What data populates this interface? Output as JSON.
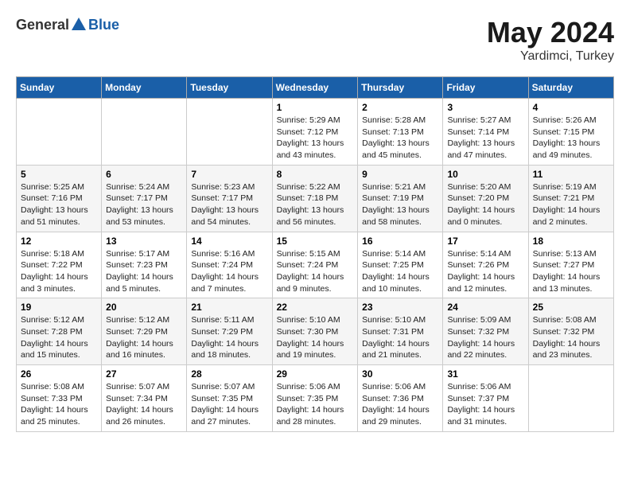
{
  "logo": {
    "text_general": "General",
    "text_blue": "Blue"
  },
  "title": {
    "month_year": "May 2024",
    "location": "Yardimci, Turkey"
  },
  "weekdays": [
    "Sunday",
    "Monday",
    "Tuesday",
    "Wednesday",
    "Thursday",
    "Friday",
    "Saturday"
  ],
  "weeks": [
    [
      {
        "day": "",
        "info": ""
      },
      {
        "day": "",
        "info": ""
      },
      {
        "day": "",
        "info": ""
      },
      {
        "day": "1",
        "info": "Sunrise: 5:29 AM\nSunset: 7:12 PM\nDaylight: 13 hours\nand 43 minutes."
      },
      {
        "day": "2",
        "info": "Sunrise: 5:28 AM\nSunset: 7:13 PM\nDaylight: 13 hours\nand 45 minutes."
      },
      {
        "day": "3",
        "info": "Sunrise: 5:27 AM\nSunset: 7:14 PM\nDaylight: 13 hours\nand 47 minutes."
      },
      {
        "day": "4",
        "info": "Sunrise: 5:26 AM\nSunset: 7:15 PM\nDaylight: 13 hours\nand 49 minutes."
      }
    ],
    [
      {
        "day": "5",
        "info": "Sunrise: 5:25 AM\nSunset: 7:16 PM\nDaylight: 13 hours\nand 51 minutes."
      },
      {
        "day": "6",
        "info": "Sunrise: 5:24 AM\nSunset: 7:17 PM\nDaylight: 13 hours\nand 53 minutes."
      },
      {
        "day": "7",
        "info": "Sunrise: 5:23 AM\nSunset: 7:17 PM\nDaylight: 13 hours\nand 54 minutes."
      },
      {
        "day": "8",
        "info": "Sunrise: 5:22 AM\nSunset: 7:18 PM\nDaylight: 13 hours\nand 56 minutes."
      },
      {
        "day": "9",
        "info": "Sunrise: 5:21 AM\nSunset: 7:19 PM\nDaylight: 13 hours\nand 58 minutes."
      },
      {
        "day": "10",
        "info": "Sunrise: 5:20 AM\nSunset: 7:20 PM\nDaylight: 14 hours\nand 0 minutes."
      },
      {
        "day": "11",
        "info": "Sunrise: 5:19 AM\nSunset: 7:21 PM\nDaylight: 14 hours\nand 2 minutes."
      }
    ],
    [
      {
        "day": "12",
        "info": "Sunrise: 5:18 AM\nSunset: 7:22 PM\nDaylight: 14 hours\nand 3 minutes."
      },
      {
        "day": "13",
        "info": "Sunrise: 5:17 AM\nSunset: 7:23 PM\nDaylight: 14 hours\nand 5 minutes."
      },
      {
        "day": "14",
        "info": "Sunrise: 5:16 AM\nSunset: 7:24 PM\nDaylight: 14 hours\nand 7 minutes."
      },
      {
        "day": "15",
        "info": "Sunrise: 5:15 AM\nSunset: 7:24 PM\nDaylight: 14 hours\nand 9 minutes."
      },
      {
        "day": "16",
        "info": "Sunrise: 5:14 AM\nSunset: 7:25 PM\nDaylight: 14 hours\nand 10 minutes."
      },
      {
        "day": "17",
        "info": "Sunrise: 5:14 AM\nSunset: 7:26 PM\nDaylight: 14 hours\nand 12 minutes."
      },
      {
        "day": "18",
        "info": "Sunrise: 5:13 AM\nSunset: 7:27 PM\nDaylight: 14 hours\nand 13 minutes."
      }
    ],
    [
      {
        "day": "19",
        "info": "Sunrise: 5:12 AM\nSunset: 7:28 PM\nDaylight: 14 hours\nand 15 minutes."
      },
      {
        "day": "20",
        "info": "Sunrise: 5:12 AM\nSunset: 7:29 PM\nDaylight: 14 hours\nand 16 minutes."
      },
      {
        "day": "21",
        "info": "Sunrise: 5:11 AM\nSunset: 7:29 PM\nDaylight: 14 hours\nand 18 minutes."
      },
      {
        "day": "22",
        "info": "Sunrise: 5:10 AM\nSunset: 7:30 PM\nDaylight: 14 hours\nand 19 minutes."
      },
      {
        "day": "23",
        "info": "Sunrise: 5:10 AM\nSunset: 7:31 PM\nDaylight: 14 hours\nand 21 minutes."
      },
      {
        "day": "24",
        "info": "Sunrise: 5:09 AM\nSunset: 7:32 PM\nDaylight: 14 hours\nand 22 minutes."
      },
      {
        "day": "25",
        "info": "Sunrise: 5:08 AM\nSunset: 7:32 PM\nDaylight: 14 hours\nand 23 minutes."
      }
    ],
    [
      {
        "day": "26",
        "info": "Sunrise: 5:08 AM\nSunset: 7:33 PM\nDaylight: 14 hours\nand 25 minutes."
      },
      {
        "day": "27",
        "info": "Sunrise: 5:07 AM\nSunset: 7:34 PM\nDaylight: 14 hours\nand 26 minutes."
      },
      {
        "day": "28",
        "info": "Sunrise: 5:07 AM\nSunset: 7:35 PM\nDaylight: 14 hours\nand 27 minutes."
      },
      {
        "day": "29",
        "info": "Sunrise: 5:06 AM\nSunset: 7:35 PM\nDaylight: 14 hours\nand 28 minutes."
      },
      {
        "day": "30",
        "info": "Sunrise: 5:06 AM\nSunset: 7:36 PM\nDaylight: 14 hours\nand 29 minutes."
      },
      {
        "day": "31",
        "info": "Sunrise: 5:06 AM\nSunset: 7:37 PM\nDaylight: 14 hours\nand 31 minutes."
      },
      {
        "day": "",
        "info": ""
      }
    ]
  ]
}
